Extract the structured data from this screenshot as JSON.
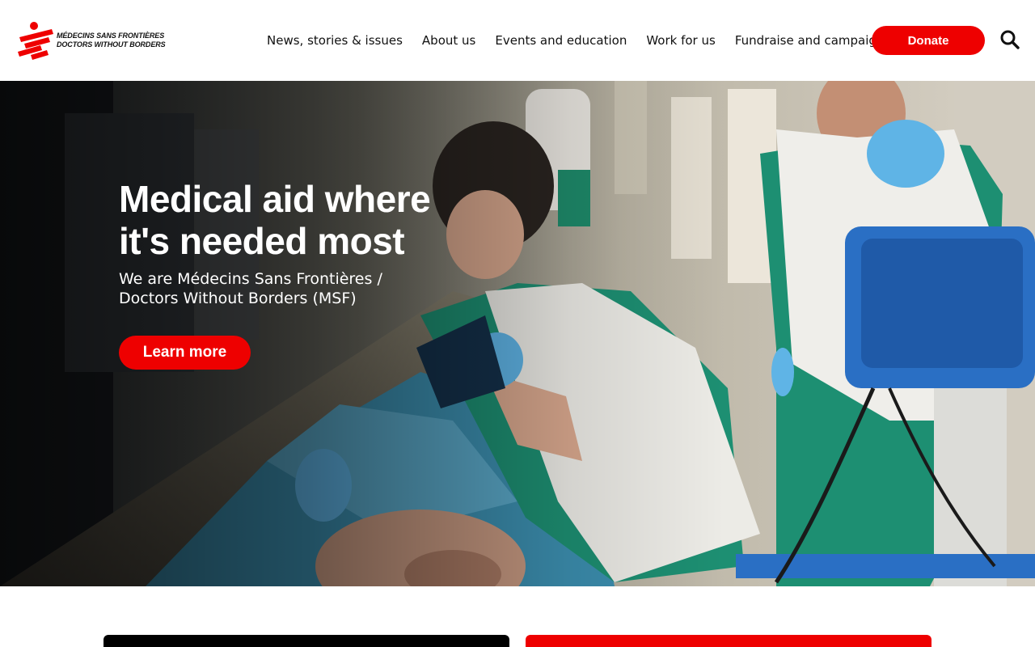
{
  "brand": {
    "logo_line1": "MÉDECINS SANS FRONTIÈRES",
    "logo_line2": "DOCTORS WITHOUT BORDERS",
    "brand_color": "#ee0000"
  },
  "nav": {
    "items": [
      {
        "label": "News, stories & issues"
      },
      {
        "label": "About us"
      },
      {
        "label": "Events and education"
      },
      {
        "label": "Work for us"
      },
      {
        "label": "Fundraise and campaign"
      }
    ],
    "donate_label": "Donate",
    "search_icon": "search-icon"
  },
  "hero": {
    "title": "Medical aid where it's needed most",
    "subtitle": "We are Médecins Sans Frontières / Doctors Without Borders (MSF)",
    "cta_label": "Learn more"
  },
  "cards": {
    "left_color": "#000000",
    "right_color": "#ee0000"
  }
}
